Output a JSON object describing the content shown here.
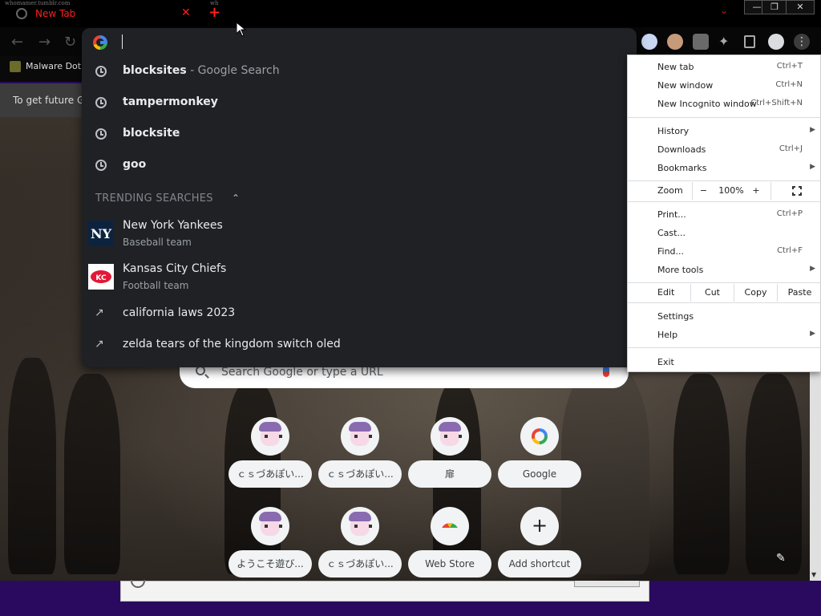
{
  "tab": {
    "url_deco": "whomamer.tumblr.com",
    "title": "New Tab",
    "close": "✕",
    "new_tab": "+",
    "extra_deco": "wh"
  },
  "window_controls": {
    "minimize": "—",
    "restore": "❐",
    "close": "✕"
  },
  "toolbar": {
    "back": "←",
    "forward": "→",
    "reload": "↻"
  },
  "bookmarks": {
    "item": "Malware Dot..."
  },
  "infobar": {
    "text": "To get future G"
  },
  "omnibox": {
    "value": "",
    "suggestions": [
      {
        "bold": "blocksites",
        "sub": " - Google Search"
      },
      {
        "bold": "tampermonkey",
        "sub": ""
      },
      {
        "bold": "blocksite",
        "sub": ""
      },
      {
        "bold": "goo",
        "sub": ""
      }
    ],
    "trending_header": "TRENDING SEARCHES",
    "trending_toggle": "⌃",
    "entities": [
      {
        "title": "New York Yankees",
        "subtitle": "Baseball team"
      },
      {
        "title": "Kansas City Chiefs",
        "subtitle": "Football team"
      }
    ],
    "trending": [
      {
        "text": "california laws 2023"
      },
      {
        "text": "zelda tears of the kingdom switch oled"
      }
    ],
    "trend_icon": "↗"
  },
  "ntp": {
    "search_placeholder": "Search Google or type a URL",
    "shortcuts": [
      {
        "label": "ｃｓづあぽい...",
        "icon": "anime-avatar"
      },
      {
        "label": "ｃｓづあぽい...",
        "icon": "anime-avatar"
      },
      {
        "label": "扉",
        "icon": "anime-avatar"
      },
      {
        "label": "Google",
        "icon": "google-g"
      },
      {
        "label": "ようこそ遊び...",
        "icon": "anime-avatar"
      },
      {
        "label": "ｃｓづあぽい...",
        "icon": "anime-avatar"
      },
      {
        "label": "Web Store",
        "icon": "web-store"
      },
      {
        "label": "Add shortcut",
        "icon": "plus"
      }
    ],
    "customize_icon": "✎"
  },
  "menu": {
    "group1": [
      {
        "label": "New tab",
        "shortcut": "Ctrl+T"
      },
      {
        "label": "New window",
        "shortcut": "Ctrl+N"
      },
      {
        "label": "New Incognito window",
        "shortcut": "Ctrl+Shift+N"
      }
    ],
    "group2": [
      {
        "label": "History",
        "shortcut": "",
        "arrow": "▶"
      },
      {
        "label": "Downloads",
        "shortcut": "Ctrl+J",
        "arrow": ""
      },
      {
        "label": "Bookmarks",
        "shortcut": "",
        "arrow": "▶"
      }
    ],
    "zoom": {
      "label": "Zoom",
      "minus": "−",
      "value": "100%",
      "plus": "+"
    },
    "group3": [
      {
        "label": "Print...",
        "shortcut": "Ctrl+P",
        "arrow": ""
      },
      {
        "label": "Cast...",
        "shortcut": "",
        "arrow": ""
      },
      {
        "label": "Find...",
        "shortcut": "Ctrl+F",
        "arrow": ""
      },
      {
        "label": "More tools",
        "shortcut": "",
        "arrow": "▶"
      }
    ],
    "edit": {
      "label": "Edit",
      "cut": "Cut",
      "copy": "Copy",
      "paste": "Paste"
    },
    "group4": [
      {
        "label": "Settings",
        "arrow": ""
      },
      {
        "label": "Help",
        "arrow": "▶"
      }
    ],
    "exit": "Exit"
  },
  "colors": {
    "tab_text": "#ff1f1f",
    "omnibox_bg": "#202124",
    "menu_bg": "#ffffff",
    "taskbar": "#2a0a5e"
  }
}
